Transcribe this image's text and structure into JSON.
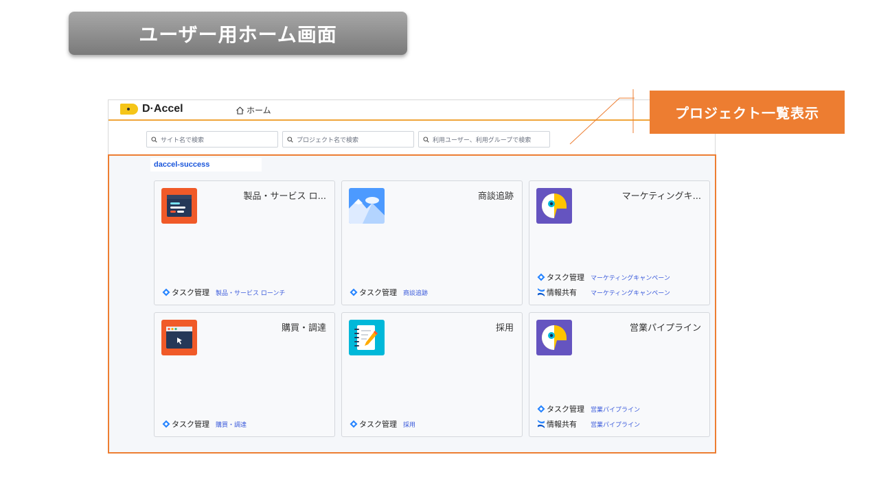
{
  "slide": {
    "title": "ユーザー用ホーム画面",
    "annotation": "プロジェクト一覧表示",
    "accent_color": "#ed7d31"
  },
  "app": {
    "logo_text": "D·Accel",
    "nav_home": "ホーム",
    "search": {
      "site_placeholder": "サイト名で検索",
      "project_placeholder": "プロジェクト名で検索",
      "user_placeholder": "利用ユーザー、利用グループで検索"
    },
    "site_name": "daccel-success",
    "projects": [
      {
        "title": "製品・サービス ロ...",
        "icon": "code-window-icon",
        "links": [
          {
            "label": "タスク管理",
            "icon": "jira-icon",
            "value": "製品・サービス ローンチ"
          }
        ]
      },
      {
        "title": "商談追跡",
        "icon": "mountain-icon",
        "links": [
          {
            "label": "タスク管理",
            "icon": "jira-icon",
            "value": "商談追跡"
          }
        ]
      },
      {
        "title": "マーケティングキ...",
        "icon": "parrot-icon",
        "links": [
          {
            "label": "タスク管理",
            "icon": "jira-icon",
            "value": "マーケティングキャンペーン"
          },
          {
            "label": "情報共有",
            "icon": "confluence-icon",
            "value": "マーケティングキャンペーン"
          }
        ]
      },
      {
        "title": "購買・調達",
        "icon": "cursor-window-icon",
        "links": [
          {
            "label": "タスク管理",
            "icon": "jira-icon",
            "value": "購買・調達"
          }
        ]
      },
      {
        "title": "採用",
        "icon": "notebook-icon",
        "links": [
          {
            "label": "タスク管理",
            "icon": "jira-icon",
            "value": "採用"
          }
        ]
      },
      {
        "title": "営業パイプライン",
        "icon": "parrot-icon",
        "links": [
          {
            "label": "タスク管理",
            "icon": "jira-icon",
            "value": "営業パイプライン"
          },
          {
            "label": "情報共有",
            "icon": "confluence-icon",
            "value": "営業パイプライン"
          }
        ]
      }
    ]
  }
}
